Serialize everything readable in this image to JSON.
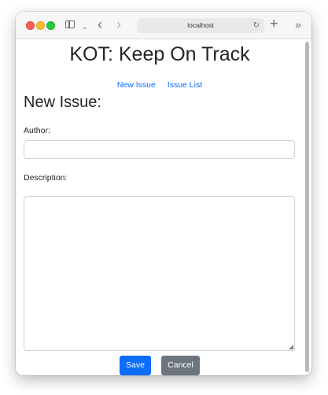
{
  "browser": {
    "address": "localhost",
    "icons": [
      "sidebar-icon",
      "chevron-down-icon",
      "back-icon",
      "forward-icon",
      "reload-icon",
      "new-tab-icon",
      "overflow-icon"
    ]
  },
  "app": {
    "title": "KOT: Keep On Track"
  },
  "nav": {
    "new_issue": "New Issue",
    "issue_list": "Issue List"
  },
  "form": {
    "heading": "New Issue:",
    "author_label": "Author:",
    "author_value": "",
    "description_label": "Description:",
    "description_value": "",
    "save_label": "Save",
    "cancel_label": "Cancel"
  },
  "colors": {
    "primary": "#0d6efd",
    "secondary": "#6c757d",
    "text": "#212529"
  }
}
